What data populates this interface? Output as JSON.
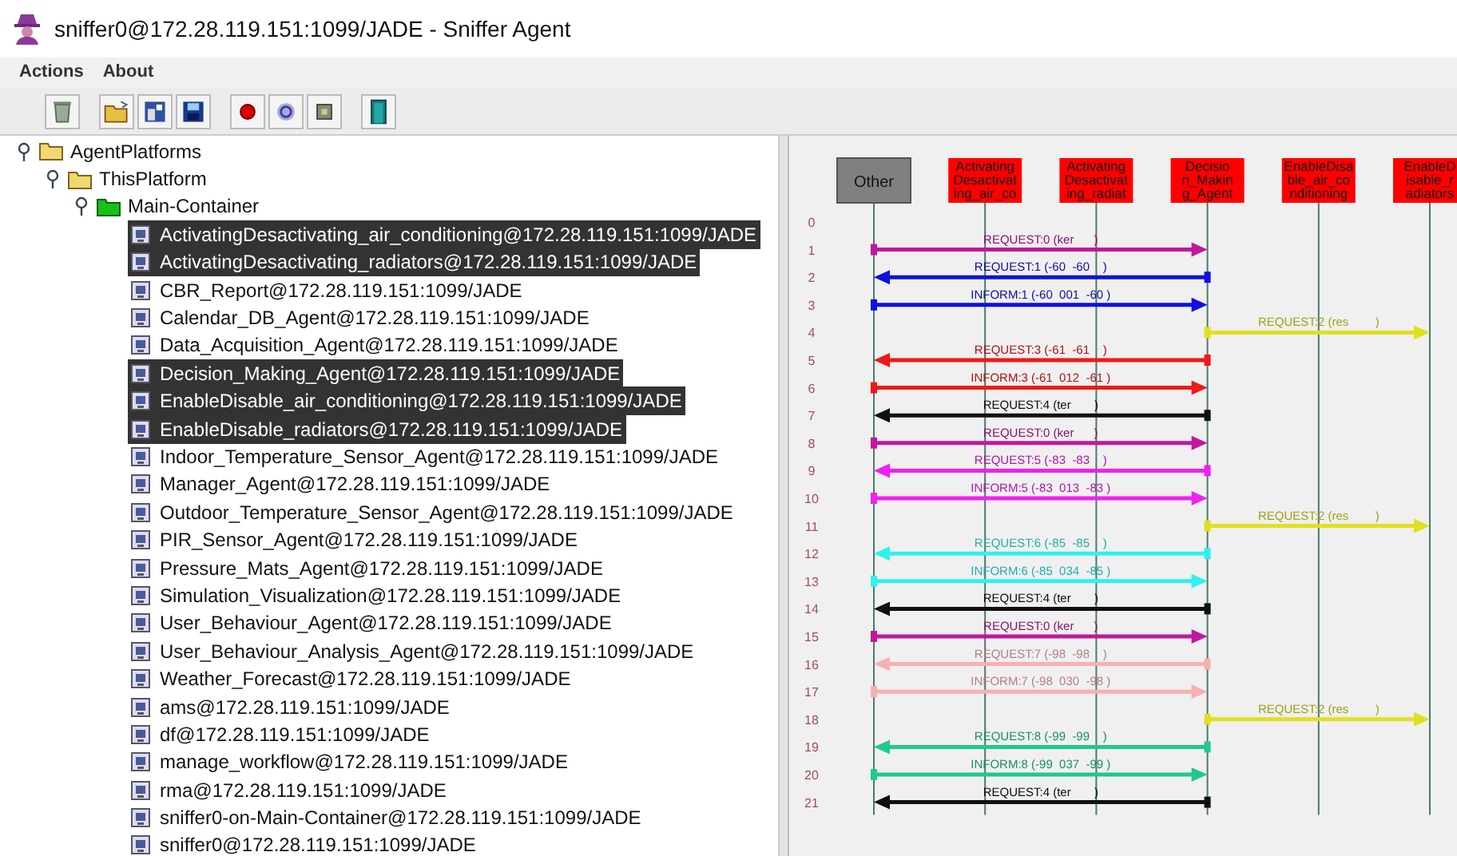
{
  "window": {
    "title": "sniffer0@172.28.119.151:1099/JADE - Sniffer Agent"
  },
  "menu": [
    "Actions",
    "About"
  ],
  "tree": {
    "label": "AgentPlatforms",
    "expanded": true,
    "children": [
      {
        "label": "ThisPlatform",
        "expanded": true,
        "children": [
          {
            "label": "Main-Container",
            "expanded": true,
            "agents": [
              {
                "label": "ActivatingDesactivating_air_conditioning@172.28.119.151:1099/JADE",
                "selected": true
              },
              {
                "label": "ActivatingDesactivating_radiators@172.28.119.151:1099/JADE",
                "selected": true
              },
              {
                "label": "CBR_Report@172.28.119.151:1099/JADE",
                "selected": false
              },
              {
                "label": "Calendar_DB_Agent@172.28.119.151:1099/JADE",
                "selected": false
              },
              {
                "label": "Data_Acquisition_Agent@172.28.119.151:1099/JADE",
                "selected": false
              },
              {
                "label": "Decision_Making_Agent@172.28.119.151:1099/JADE",
                "selected": true
              },
              {
                "label": "EnableDisable_air_conditioning@172.28.119.151:1099/JADE",
                "selected": true
              },
              {
                "label": "EnableDisable_radiators@172.28.119.151:1099/JADE",
                "selected": true
              },
              {
                "label": "Indoor_Temperature_Sensor_Agent@172.28.119.151:1099/JADE",
                "selected": false
              },
              {
                "label": "Manager_Agent@172.28.119.151:1099/JADE",
                "selected": false
              },
              {
                "label": "Outdoor_Temperature_Sensor_Agent@172.28.119.151:1099/JADE",
                "selected": false
              },
              {
                "label": "PIR_Sensor_Agent@172.28.119.151:1099/JADE",
                "selected": false
              },
              {
                "label": "Pressure_Mats_Agent@172.28.119.151:1099/JADE",
                "selected": false
              },
              {
                "label": "Simulation_Visualization@172.28.119.151:1099/JADE",
                "selected": false
              },
              {
                "label": "User_Behaviour_Agent@172.28.119.151:1099/JADE",
                "selected": false
              },
              {
                "label": "User_Behaviour_Analysis_Agent@172.28.119.151:1099/JADE",
                "selected": false
              },
              {
                "label": "Weather_Forecast@172.28.119.151:1099/JADE",
                "selected": false
              },
              {
                "label": "ams@172.28.119.151:1099/JADE",
                "selected": false
              },
              {
                "label": "df@172.28.119.151:1099/JADE",
                "selected": false
              },
              {
                "label": "manage_workflow@172.28.119.151:1099/JADE",
                "selected": false
              },
              {
                "label": "rma@172.28.119.151:1099/JADE",
                "selected": false
              },
              {
                "label": "sniffer0-on-Main-Container@172.28.119.151:1099/JADE",
                "selected": false
              },
              {
                "label": "sniffer0@172.28.119.151:1099/JADE",
                "selected": false
              }
            ]
          }
        ]
      }
    ]
  },
  "sniffer": {
    "agents": [
      {
        "lines": [
          "Other"
        ],
        "color": "#808080"
      },
      {
        "lines": [
          "Activating",
          "Desactivat",
          "ing_air_co"
        ],
        "color": "#ff0000"
      },
      {
        "lines": [
          "Activating",
          "Desactivat",
          "ing_radiat"
        ],
        "color": "#ff0000"
      },
      {
        "lines": [
          "Decisio",
          "n_Makin",
          "g_Agent"
        ],
        "color": "#ff0000"
      },
      {
        "lines": [
          "EnableDisa",
          "ble_air_co",
          "nditioning"
        ],
        "color": "#ff0000"
      },
      {
        "lines": [
          "EnableD",
          "isable_r",
          "adiators"
        ],
        "color": "#ff0000"
      }
    ],
    "rows": [
      {
        "number": "0"
      },
      {
        "number": "1",
        "message": {
          "label": "REQUEST:0 (ker      )",
          "kind": "outgoing",
          "color": "#c0189c"
        }
      },
      {
        "number": "2",
        "message": {
          "label": "REQUEST:1 (-60  -60    )",
          "kind": "incoming",
          "color": "#1010e0"
        }
      },
      {
        "number": "3",
        "message": {
          "label": "INFORM:1 (-60  001  -60 )",
          "kind": "outgoing",
          "color": "#1010e0"
        }
      },
      {
        "number": "4",
        "message": {
          "label": "REQUEST:2 (res        )",
          "kind": "forward",
          "color": "#e0e020"
        }
      },
      {
        "number": "5",
        "message": {
          "label": "REQUEST:3 (-61  -61    )",
          "kind": "incoming",
          "color": "#f01818"
        }
      },
      {
        "number": "6",
        "message": {
          "label": "INFORM:3 (-61  012  -61 )",
          "kind": "outgoing",
          "color": "#f01818"
        }
      },
      {
        "number": "7",
        "message": {
          "label": "REQUEST:4 (ter       )",
          "kind": "incoming",
          "color": "#101010"
        }
      },
      {
        "number": "8",
        "message": {
          "label": "REQUEST:0 (ker      )",
          "kind": "outgoing",
          "color": "#c0189c"
        }
      },
      {
        "number": "9",
        "message": {
          "label": "REQUEST:5 (-83  -83    )",
          "kind": "incoming",
          "color": "#f020f0"
        }
      },
      {
        "number": "10",
        "message": {
          "label": "INFORM:5 (-83  013  -83 )",
          "kind": "outgoing",
          "color": "#f020f0"
        }
      },
      {
        "number": "11",
        "message": {
          "label": "REQUEST:2 (res        )",
          "kind": "forward",
          "color": "#e0e020"
        }
      },
      {
        "number": "12",
        "message": {
          "label": "REQUEST:6 (-85  -85    )",
          "kind": "incoming",
          "color": "#30f0f0"
        }
      },
      {
        "number": "13",
        "message": {
          "label": "INFORM:6 (-85  034  -85 )",
          "kind": "outgoing",
          "color": "#30f0f0"
        }
      },
      {
        "number": "14",
        "message": {
          "label": "REQUEST:4 (ter       )",
          "kind": "incoming",
          "color": "#101010"
        }
      },
      {
        "number": "15",
        "message": {
          "label": "REQUEST:0 (ker      )",
          "kind": "outgoing",
          "color": "#c0189c"
        }
      },
      {
        "number": "16",
        "message": {
          "label": "REQUEST:7 (-98  -98    )",
          "kind": "incoming",
          "color": "#f8b0b0"
        }
      },
      {
        "number": "17",
        "message": {
          "label": "INFORM:7 (-98  030  -98 )",
          "kind": "outgoing",
          "color": "#f8b0b0"
        }
      },
      {
        "number": "18",
        "message": {
          "label": "REQUEST:2 (res        )",
          "kind": "forward",
          "color": "#e0e020"
        }
      },
      {
        "number": "19",
        "message": {
          "label": "REQUEST:8 (-99  -99    )",
          "kind": "incoming",
          "color": "#20c890"
        }
      },
      {
        "number": "20",
        "message": {
          "label": "INFORM:8 (-99  037  -99 )",
          "kind": "outgoing",
          "color": "#20c890"
        }
      },
      {
        "number": "21",
        "message": {
          "label": "REQUEST:4 (ter       )",
          "kind": "incoming",
          "color": "#101010"
        }
      }
    ]
  }
}
